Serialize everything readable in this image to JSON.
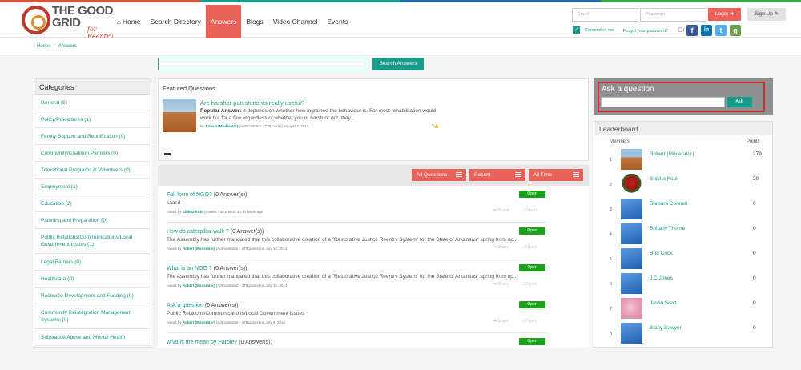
{
  "brand": {
    "line1": "THE",
    "line2": "GOOD",
    "line3": "GRID",
    "tagline": "for Reentry"
  },
  "nav": [
    {
      "label": "Home",
      "icon": "home-icon",
      "active": false
    },
    {
      "label": "Search Directory",
      "active": false
    },
    {
      "label": "Answers",
      "active": true
    },
    {
      "label": "Blogs",
      "active": false
    },
    {
      "label": "Video Channel",
      "active": false
    },
    {
      "label": "Events",
      "active": false
    }
  ],
  "auth": {
    "email_placeholder": "Email",
    "password_placeholder": "Password",
    "login_label": "Login",
    "signup_label": "Sign Up",
    "remember_label": "Remember me",
    "forgot_label": "Forgot your password?",
    "or_label": "Or"
  },
  "social": [
    {
      "name": "facebook-icon",
      "glyph": "f",
      "color": "#3b5998"
    },
    {
      "name": "linkedin-icon",
      "glyph": "in",
      "color": "#0e76a8"
    },
    {
      "name": "twitter-icon",
      "glyph": "t",
      "color": "#55acee"
    },
    {
      "name": "google-icon",
      "glyph": "g",
      "color": "#6b9e48"
    }
  ],
  "breadcrumb": {
    "home": "Home",
    "sep": "/",
    "current": "Answers"
  },
  "search": {
    "placeholder": "",
    "button": "Search Answers"
  },
  "categories": {
    "title": "Categories",
    "items": [
      "General (5)",
      "Policy/Procedures (1)",
      "Family Support and Reunification (0)",
      "Community/Coalition Partners (0)",
      "Transitional Programs & Volunteers (0)",
      "Employment (1)",
      "Education (2)",
      "Planning and Preparation (0)",
      "Public Relations/Communications/Local Government Issues (1)",
      "Legal Barriers (0)",
      "Healthcare (0)",
      "Resource Development and Funding (0)",
      "Community Reintegration Management Systems (0)",
      "Substance Abuse and Mental Health"
    ]
  },
  "featured": {
    "title": "Featured Questions",
    "question": "Are harsher punishments really useful?",
    "popular_label": "Popular Answer:",
    "answer": "It depends on whether how ingrained the behaviour is. For most rehabilitation would work but for a few regardless of whether you or harsh or not, they...",
    "by": "By",
    "user": "Robert (Moderator)",
    "meta": "(Administrator - 279 points)  on April 2, 2014",
    "likes": "2"
  },
  "filters": {
    "all": "All Questions",
    "recent": "Recent",
    "time": "All Time"
  },
  "questions": [
    {
      "title": "Full form of NGO?",
      "answers": "(0 Answer(s))",
      "body": "saasd",
      "asked": "Asked by",
      "user": "Shikha Koul",
      "meta": "(Rookie - 20 points)  on 16 hours ago",
      "status": "Open"
    },
    {
      "title": "How do caterpillar walk ?",
      "answers": "(0 Answer(s))",
      "body": "The Assembly has further mandated that this collaborative creation of a \"Restorative Justice Reentry System\" for the State of Arkansas\" spring from op...",
      "asked": "Asked by",
      "user": "Robert (Moderator)",
      "meta": "(Administrator - 279 points)  on July 15, 2014",
      "status": "Open"
    },
    {
      "title": "What is an NGO ?",
      "answers": "(0 Answer(s))",
      "body": "The Assembly has further mandated that this collaborative creation of a \"Restorative Justice Reentry System\" for the State of Arkansas\" spring from op...",
      "asked": "Asked by",
      "user": "Robert (Moderator)",
      "meta": "(Administrator - 279 points)  on July 15, 2014",
      "status": "Open"
    },
    {
      "title": "Ask a question",
      "answers": "(0 Answer(s))",
      "body": "Public Relations/Communications/Local Government Issues",
      "asked": "Asked by",
      "user": "Robert (Moderator)",
      "meta": "(Administrator - 279 points)  on July 4, 2014",
      "status": "Open"
    },
    {
      "title": "what is the mean by Parole?",
      "answers": "(0 Answer(s))",
      "body": "",
      "asked": "",
      "user": "",
      "meta": "",
      "status": "Open"
    }
  ],
  "actions": {
    "share": "Share",
    "open": "Open"
  },
  "ask": {
    "title": "Ask a question",
    "button": "Ask"
  },
  "leaderboard": {
    "title": "Leaderboard",
    "col_members": "Members",
    "col_points": "Points",
    "rows": [
      {
        "rank": "1",
        "name": "Robert (Moderator)",
        "points": "279",
        "avatar": "desert"
      },
      {
        "rank": "2",
        "name": "Shikha Koul",
        "points": "20",
        "avatar": "flower"
      },
      {
        "rank": "3",
        "name": "Barbara Connell",
        "points": "0",
        "avatar": "default"
      },
      {
        "rank": "4",
        "name": "Brittany Thorne",
        "points": "0",
        "avatar": "default"
      },
      {
        "rank": "5",
        "name": "Bret Crick",
        "points": "0",
        "avatar": "default"
      },
      {
        "rank": "6",
        "name": "J.C Jones",
        "points": "0",
        "avatar": "default"
      },
      {
        "rank": "7",
        "name": "Justin Scott",
        "points": "0",
        "avatar": "pink"
      },
      {
        "rank": "8",
        "name": "Stacy Sawyer",
        "points": "0",
        "avatar": "default"
      }
    ]
  }
}
